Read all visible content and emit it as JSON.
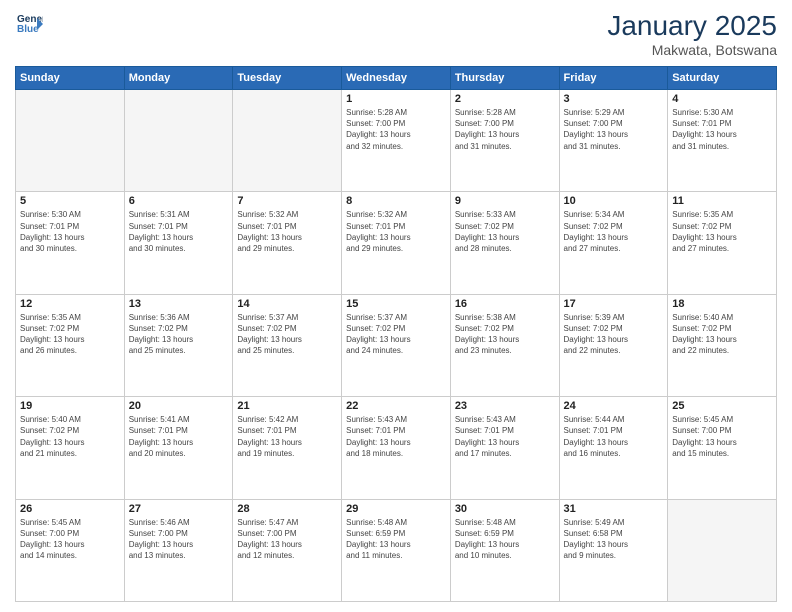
{
  "logo": {
    "line1": "General",
    "line2": "Blue"
  },
  "title": "January 2025",
  "subtitle": "Makwata, Botswana",
  "days_of_week": [
    "Sunday",
    "Monday",
    "Tuesday",
    "Wednesday",
    "Thursday",
    "Friday",
    "Saturday"
  ],
  "weeks": [
    [
      {
        "day": "",
        "info": ""
      },
      {
        "day": "",
        "info": ""
      },
      {
        "day": "",
        "info": ""
      },
      {
        "day": "1",
        "info": "Sunrise: 5:28 AM\nSunset: 7:00 PM\nDaylight: 13 hours\nand 32 minutes."
      },
      {
        "day": "2",
        "info": "Sunrise: 5:28 AM\nSunset: 7:00 PM\nDaylight: 13 hours\nand 31 minutes."
      },
      {
        "day": "3",
        "info": "Sunrise: 5:29 AM\nSunset: 7:00 PM\nDaylight: 13 hours\nand 31 minutes."
      },
      {
        "day": "4",
        "info": "Sunrise: 5:30 AM\nSunset: 7:01 PM\nDaylight: 13 hours\nand 31 minutes."
      }
    ],
    [
      {
        "day": "5",
        "info": "Sunrise: 5:30 AM\nSunset: 7:01 PM\nDaylight: 13 hours\nand 30 minutes."
      },
      {
        "day": "6",
        "info": "Sunrise: 5:31 AM\nSunset: 7:01 PM\nDaylight: 13 hours\nand 30 minutes."
      },
      {
        "day": "7",
        "info": "Sunrise: 5:32 AM\nSunset: 7:01 PM\nDaylight: 13 hours\nand 29 minutes."
      },
      {
        "day": "8",
        "info": "Sunrise: 5:32 AM\nSunset: 7:01 PM\nDaylight: 13 hours\nand 29 minutes."
      },
      {
        "day": "9",
        "info": "Sunrise: 5:33 AM\nSunset: 7:02 PM\nDaylight: 13 hours\nand 28 minutes."
      },
      {
        "day": "10",
        "info": "Sunrise: 5:34 AM\nSunset: 7:02 PM\nDaylight: 13 hours\nand 27 minutes."
      },
      {
        "day": "11",
        "info": "Sunrise: 5:35 AM\nSunset: 7:02 PM\nDaylight: 13 hours\nand 27 minutes."
      }
    ],
    [
      {
        "day": "12",
        "info": "Sunrise: 5:35 AM\nSunset: 7:02 PM\nDaylight: 13 hours\nand 26 minutes."
      },
      {
        "day": "13",
        "info": "Sunrise: 5:36 AM\nSunset: 7:02 PM\nDaylight: 13 hours\nand 25 minutes."
      },
      {
        "day": "14",
        "info": "Sunrise: 5:37 AM\nSunset: 7:02 PM\nDaylight: 13 hours\nand 25 minutes."
      },
      {
        "day": "15",
        "info": "Sunrise: 5:37 AM\nSunset: 7:02 PM\nDaylight: 13 hours\nand 24 minutes."
      },
      {
        "day": "16",
        "info": "Sunrise: 5:38 AM\nSunset: 7:02 PM\nDaylight: 13 hours\nand 23 minutes."
      },
      {
        "day": "17",
        "info": "Sunrise: 5:39 AM\nSunset: 7:02 PM\nDaylight: 13 hours\nand 22 minutes."
      },
      {
        "day": "18",
        "info": "Sunrise: 5:40 AM\nSunset: 7:02 PM\nDaylight: 13 hours\nand 22 minutes."
      }
    ],
    [
      {
        "day": "19",
        "info": "Sunrise: 5:40 AM\nSunset: 7:02 PM\nDaylight: 13 hours\nand 21 minutes."
      },
      {
        "day": "20",
        "info": "Sunrise: 5:41 AM\nSunset: 7:01 PM\nDaylight: 13 hours\nand 20 minutes."
      },
      {
        "day": "21",
        "info": "Sunrise: 5:42 AM\nSunset: 7:01 PM\nDaylight: 13 hours\nand 19 minutes."
      },
      {
        "day": "22",
        "info": "Sunrise: 5:43 AM\nSunset: 7:01 PM\nDaylight: 13 hours\nand 18 minutes."
      },
      {
        "day": "23",
        "info": "Sunrise: 5:43 AM\nSunset: 7:01 PM\nDaylight: 13 hours\nand 17 minutes."
      },
      {
        "day": "24",
        "info": "Sunrise: 5:44 AM\nSunset: 7:01 PM\nDaylight: 13 hours\nand 16 minutes."
      },
      {
        "day": "25",
        "info": "Sunrise: 5:45 AM\nSunset: 7:00 PM\nDaylight: 13 hours\nand 15 minutes."
      }
    ],
    [
      {
        "day": "26",
        "info": "Sunrise: 5:45 AM\nSunset: 7:00 PM\nDaylight: 13 hours\nand 14 minutes."
      },
      {
        "day": "27",
        "info": "Sunrise: 5:46 AM\nSunset: 7:00 PM\nDaylight: 13 hours\nand 13 minutes."
      },
      {
        "day": "28",
        "info": "Sunrise: 5:47 AM\nSunset: 7:00 PM\nDaylight: 13 hours\nand 12 minutes."
      },
      {
        "day": "29",
        "info": "Sunrise: 5:48 AM\nSunset: 6:59 PM\nDaylight: 13 hours\nand 11 minutes."
      },
      {
        "day": "30",
        "info": "Sunrise: 5:48 AM\nSunset: 6:59 PM\nDaylight: 13 hours\nand 10 minutes."
      },
      {
        "day": "31",
        "info": "Sunrise: 5:49 AM\nSunset: 6:58 PM\nDaylight: 13 hours\nand 9 minutes."
      },
      {
        "day": "",
        "info": ""
      }
    ]
  ]
}
